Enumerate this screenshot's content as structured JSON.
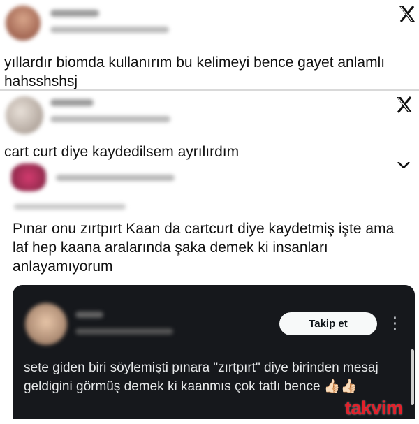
{
  "tweets": [
    {
      "text": "yıllardır biomda kullanırım bu kelimeyi bence gayet anlamlı hahsshshsj"
    },
    {
      "text": "cart curt diye kaydedilsem ayrılırdım"
    },
    {
      "text": "Pınar onu zırtpırt Kaan da cartcurt diye kaydetmiş işte ama laf hep kaana aralarında şaka demek ki insanları anlayamıyorum"
    }
  ],
  "embedded_post": {
    "follow_label": "Takip et",
    "more_icon": "more-dots-icon",
    "text": "sete giden biri söylemişti pınara \"zırtpırt\" diye birinden mesaj geldigini görmüş demek ki kaanmıs çok tatlı bence 👍🏻👍🏻"
  },
  "watermark": {
    "label": "takvim"
  },
  "colors": {
    "dark_card_bg": "#16181c",
    "follow_btn_bg": "#f7f9f9",
    "watermark_red": "#e3202a"
  }
}
